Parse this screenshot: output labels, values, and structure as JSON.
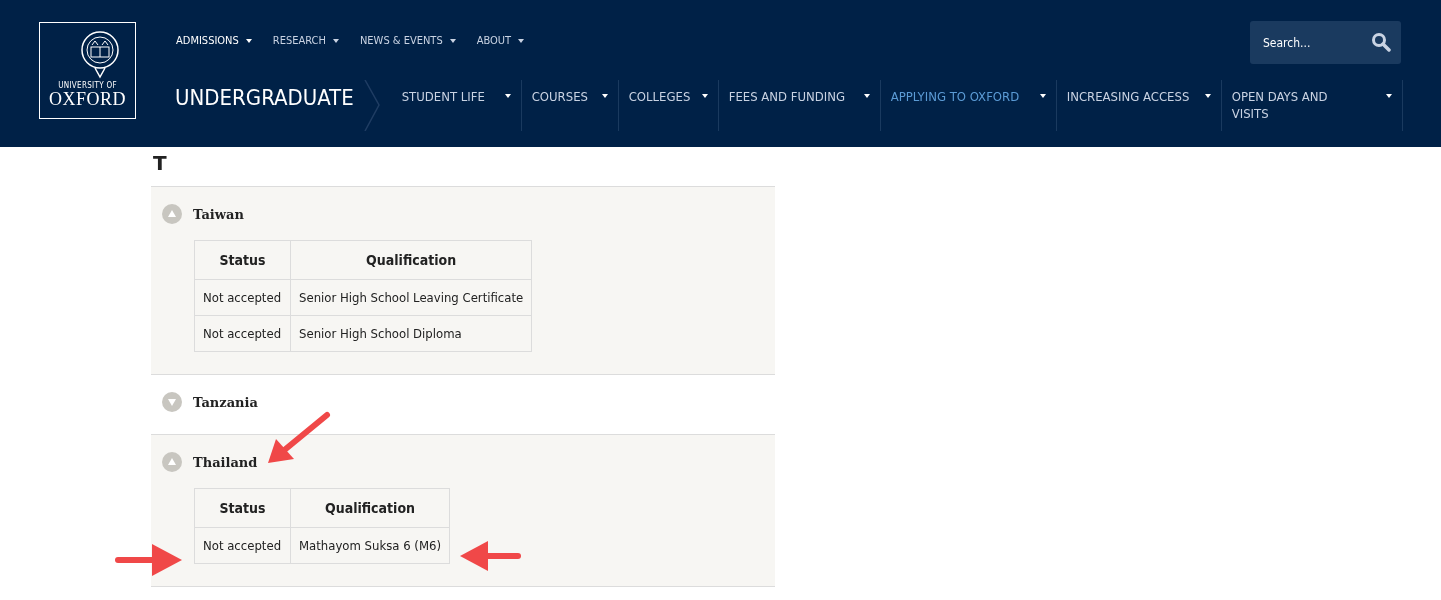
{
  "logo": {
    "line_1": "UNIVERSITY OF",
    "line_2": "OXFORD"
  },
  "top_nav": [
    {
      "label": "ADMISSIONS",
      "selected": true
    },
    {
      "label": "RESEARCH",
      "selected": false
    },
    {
      "label": "NEWS & EVENTS",
      "selected": false
    },
    {
      "label": "ABOUT",
      "selected": false
    }
  ],
  "search": {
    "placeholder": "Search..."
  },
  "section_title": "UNDERGRADUATE",
  "section_nav": [
    {
      "label": "STUDENT LIFE",
      "selected": false
    },
    {
      "label": "COURSES",
      "selected": false
    },
    {
      "label": "COLLEGES",
      "selected": false
    },
    {
      "label": "FEES AND FUNDING",
      "selected": false
    },
    {
      "label": "APPLYING TO OXFORD",
      "selected": true
    },
    {
      "label": "INCREASING ACCESS",
      "selected": false
    },
    {
      "label": "OPEN DAYS AND VISITS",
      "selected": false
    }
  ],
  "letter_heading": "T",
  "countries": [
    {
      "name": "Taiwan",
      "expanded": true,
      "columns": [
        "Status",
        "Qualification"
      ],
      "rows": [
        [
          "Not accepted",
          "Senior High School Leaving Certificate"
        ],
        [
          "Not accepted",
          "Senior High School Diploma"
        ]
      ]
    },
    {
      "name": "Tanzania",
      "expanded": false
    },
    {
      "name": "Thailand",
      "expanded": true,
      "columns": [
        "Status",
        "Qualification"
      ],
      "rows": [
        [
          "Not accepted",
          "Mathayom Suksa 6 (M6)"
        ]
      ]
    }
  ]
}
